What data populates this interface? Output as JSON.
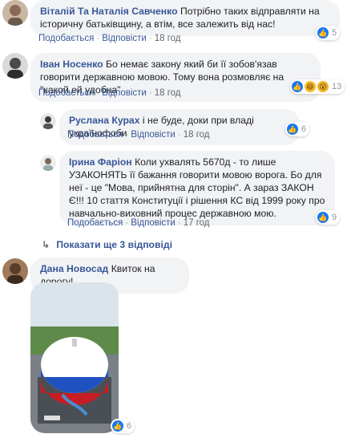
{
  "comments": [
    {
      "author": "Віталій Та Наталія Савченко",
      "text": "Потрібно таких відправляти на історичну батьківщину, а втім, все залежить від нас!",
      "like_label": "Подобається",
      "reply_label": "Відповісти",
      "time": "18 год",
      "reaction_count": "5",
      "reaction_icons": [
        "like-icon"
      ]
    },
    {
      "author": "Іван Носенко",
      "text": "Бо немає закону який би її зобов'язав говорити державною мовою. Тому вона розмовляє на \"какой ей удобна\"",
      "like_label": "Подобається",
      "reply_label": "Відповісти",
      "time": "18 год",
      "reaction_count": "13",
      "reaction_icons": [
        "like-icon",
        "haha-icon",
        "wow-icon"
      ]
    },
    {
      "author": "Руслана Курах",
      "text": "і не буде, доки при владі українофоби",
      "like_label": "Подобається",
      "reply_label": "Відповісти",
      "time": "18 год",
      "reaction_count": "6",
      "reaction_icons": [
        "like-icon"
      ]
    },
    {
      "author": "Ірина Фаріон",
      "text": "Коли ухвалять 5670д - то лише УЗАКОНЯТЬ її бажання говорити мовою ворога. Бо для неї - це \"Мова, прийнятна для сторін\". А зараз ЗАКОН Є!!! 10 стаття Конституції і рішення КС від 1999 року про навчально-виховний процес державною мою.",
      "like_label": "Подобається",
      "reply_label": "Відповісти",
      "time": "17 год",
      "reaction_count": "9",
      "reaction_icons": [
        "like-icon"
      ]
    },
    {
      "author": "Дана Новосад",
      "text": "Квиток на дорогу!",
      "reaction_count": "6",
      "reaction_icons": [
        "like-icon"
      ]
    }
  ],
  "show_more_replies": "Показати ще 3 відповіді",
  "colors": {
    "link": "#385898",
    "bubble": "#f2f3f5",
    "like": "#1877f2",
    "meta": "#606770"
  }
}
